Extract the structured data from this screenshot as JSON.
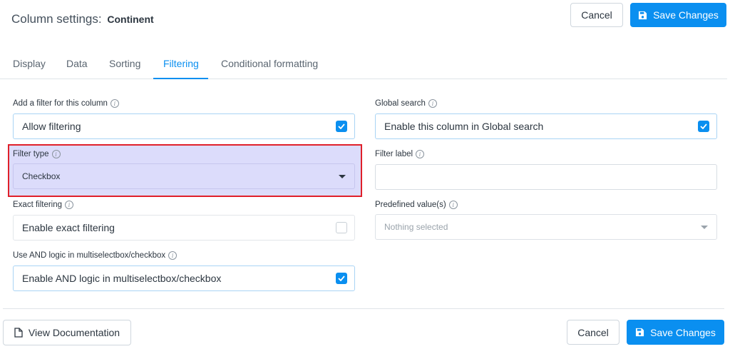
{
  "header": {
    "title_prefix": "Column settings:",
    "column_name": "Continent",
    "cancel_label": "Cancel",
    "save_label": "Save Changes"
  },
  "tabs": [
    {
      "label": "Display"
    },
    {
      "label": "Data"
    },
    {
      "label": "Sorting"
    },
    {
      "label": "Filtering",
      "active": true
    },
    {
      "label": "Conditional formatting"
    }
  ],
  "left": {
    "add_filter": {
      "label": "Add a filter for this column",
      "field_text": "Allow filtering",
      "checked": true
    },
    "filter_type": {
      "label": "Filter type",
      "value": "Checkbox"
    },
    "exact_filtering": {
      "label": "Exact filtering",
      "field_text": "Enable exact filtering",
      "checked": false
    },
    "and_logic": {
      "label": "Use AND logic in multiselectbox/checkbox",
      "field_text": "Enable AND logic in multiselectbox/checkbox",
      "checked": true
    }
  },
  "right": {
    "global_search": {
      "label": "Global search",
      "field_text": "Enable this column in Global search",
      "checked": true
    },
    "filter_label": {
      "label": "Filter label",
      "value": ""
    },
    "predefined": {
      "label": "Predefined value(s)",
      "placeholder": "Nothing selected"
    }
  },
  "footer": {
    "docs_label": "View Documentation",
    "cancel_label": "Cancel",
    "save_label": "Save Changes"
  },
  "colors": {
    "accent": "#0a8ff0",
    "highlight_border": "#e0202a",
    "highlight_fill": "#dcdcfb"
  }
}
